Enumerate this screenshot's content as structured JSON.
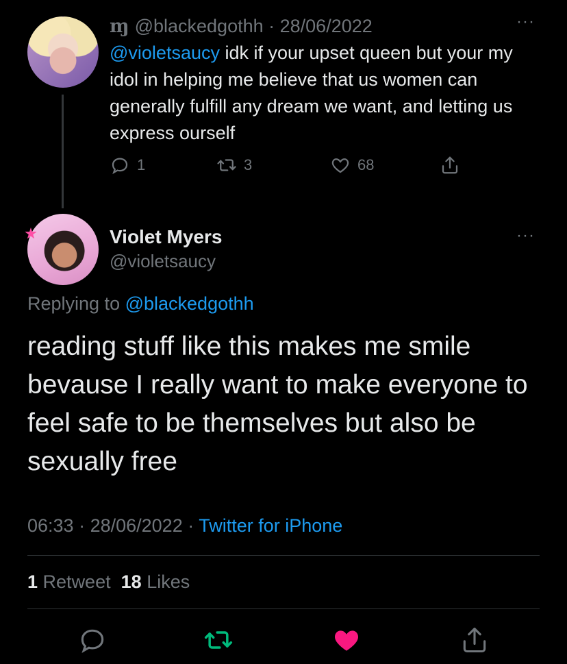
{
  "parent": {
    "handle": "@blackedgothh",
    "separator": " · ",
    "date": "28/06/2022",
    "name_glyph": "ɱ",
    "mention": "@violetsaucy",
    "text": " idk if your upset queen but your my idol in helping me believe that us women can generally fulfill any dream we want, and letting us express ourself",
    "more": "···",
    "actions": {
      "reply_count": "1",
      "retweet_count": "3",
      "like_count": "68"
    }
  },
  "tweet": {
    "name": "Violet Myers",
    "handle": "@violetsaucy",
    "more": "···",
    "replying_prefix": "Replying to ",
    "replying_handle": "@blackedgothh",
    "text": "reading stuff like this makes me smile bevause I really want to make everyone to feel safe to be themselves but also be sexually free",
    "time": "06:33",
    "date": "28/06/2022",
    "separator": " · ",
    "source": "Twitter for iPhone",
    "retweets_count": "1",
    "retweets_label": "Retweet",
    "likes_count": "18",
    "likes_label": "Likes"
  },
  "colors": {
    "background": "#000000",
    "text": "#e7e9ea",
    "muted": "#71767b",
    "link": "#1d9bf0",
    "retweet_active": "#00ba7c",
    "like_active": "#f91880"
  },
  "icons": {
    "reply": "reply-icon",
    "retweet": "retweet-icon",
    "like": "heart-icon",
    "share": "share-icon"
  }
}
